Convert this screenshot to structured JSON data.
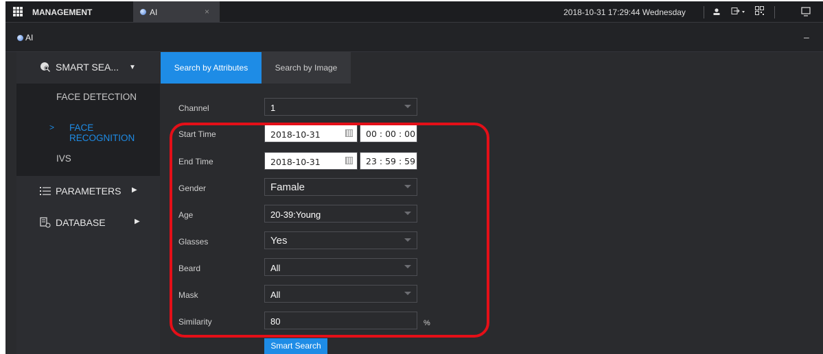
{
  "topbar": {
    "management_label": "MANAGEMENT",
    "ai_tab_label": "AI",
    "close_symbol": "×",
    "datetime": "2018-10-31 17:29:44 Wednesday",
    "icons": [
      "user-icon",
      "logout-icon",
      "qr-code-icon",
      "monitor-icon"
    ]
  },
  "ai_header": {
    "title": "AI",
    "minimize_symbol": "–"
  },
  "sidebar": {
    "smart_search": {
      "label": "SMART SEA...",
      "icon": "smart-search-icon"
    },
    "sub_items": [
      {
        "label": "FACE DETECTION",
        "active": false
      },
      {
        "label": "FACE RECOGNITION",
        "active": true
      },
      {
        "label": "IVS",
        "active": false
      }
    ],
    "parameters": {
      "label": "PARAMETERS",
      "icon": "list-icon"
    },
    "database": {
      "label": "DATABASE",
      "icon": "database-icon"
    }
  },
  "tabs": {
    "attributes": "Search by Attributes",
    "image": "Search by Image"
  },
  "form": {
    "channel": {
      "label": "Channel",
      "value": "1"
    },
    "start_time": {
      "label": "Start Time",
      "date": "2018-10-31",
      "time": "00 : 00 : 00"
    },
    "end_time": {
      "label": "End Time",
      "date": "2018-10-31",
      "time": "23 : 59 : 59"
    },
    "gender": {
      "label": "Gender",
      "value": "Famale"
    },
    "age": {
      "label": "Age",
      "value": "20-39:Young"
    },
    "glasses": {
      "label": "Glasses",
      "value": "Yes"
    },
    "beard": {
      "label": "Beard",
      "value": "All"
    },
    "mask": {
      "label": "Mask",
      "value": "All"
    },
    "similarity": {
      "label": "Similarity",
      "value": "80",
      "unit": "%"
    }
  },
  "smart_search_button": "Smart Search",
  "colors": {
    "accent": "#1e8ce6",
    "highlight": "#e40f18",
    "background": "#2a2b2e"
  }
}
